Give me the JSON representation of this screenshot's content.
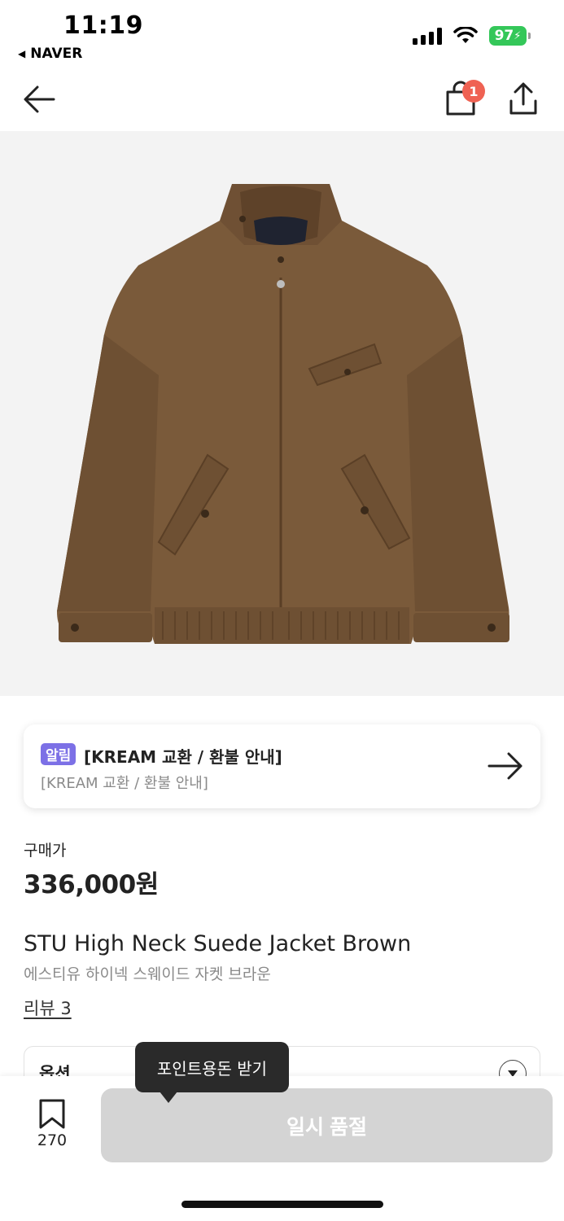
{
  "status_bar": {
    "time": "11:19",
    "back_app": "NAVER",
    "battery": "97"
  },
  "nav": {
    "cart_badge": "1",
    "icons": [
      "back-arrow-icon",
      "shopping-bag-icon",
      "share-icon"
    ]
  },
  "product_image": {
    "description_icon": "jacket-image",
    "jacket_color": "#7a5a3a",
    "background_color": "#f3f3f3"
  },
  "notice": {
    "badge": "알림",
    "title": "[KREAM 교환 / 환불 안내]",
    "subtitle": "[KREAM 교환 / 환불 안내]",
    "badge_color": "#7c70e6"
  },
  "price": {
    "label": "구매가",
    "value": "336,000원"
  },
  "product": {
    "name": "STU High Neck Suede Jacket Brown",
    "name_ko": "에스티유 하이넥 스웨이드 자켓 브라운",
    "review_link": "리뷰 3"
  },
  "option": {
    "label": "옵션"
  },
  "bottom_bar": {
    "wishlist_count": "270",
    "soldout_label": "일시 품절",
    "tooltip": "포인트용돈 받기"
  }
}
